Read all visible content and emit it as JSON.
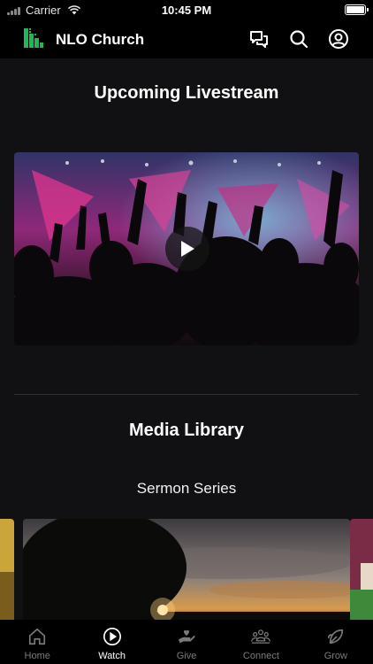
{
  "status_bar": {
    "carrier": "Carrier",
    "time": "10:45 PM"
  },
  "header": {
    "title": "NLO Church",
    "icons": [
      "chat-icon",
      "search-icon",
      "profile-icon"
    ],
    "accent": "#1db954"
  },
  "upcoming": {
    "title": "Upcoming Livestream",
    "video": {
      "description_icon": "play-icon"
    }
  },
  "media_library": {
    "title": "Media Library",
    "subtitle": "Sermon Series"
  },
  "tabs": [
    {
      "label": "Home",
      "icon": "home-icon",
      "active": false
    },
    {
      "label": "Watch",
      "icon": "play-circle-icon",
      "active": true
    },
    {
      "label": "Give",
      "icon": "give-icon",
      "active": false
    },
    {
      "label": "Connect",
      "icon": "people-icon",
      "active": false
    },
    {
      "label": "Grow",
      "icon": "leaf-icon",
      "active": false
    }
  ]
}
